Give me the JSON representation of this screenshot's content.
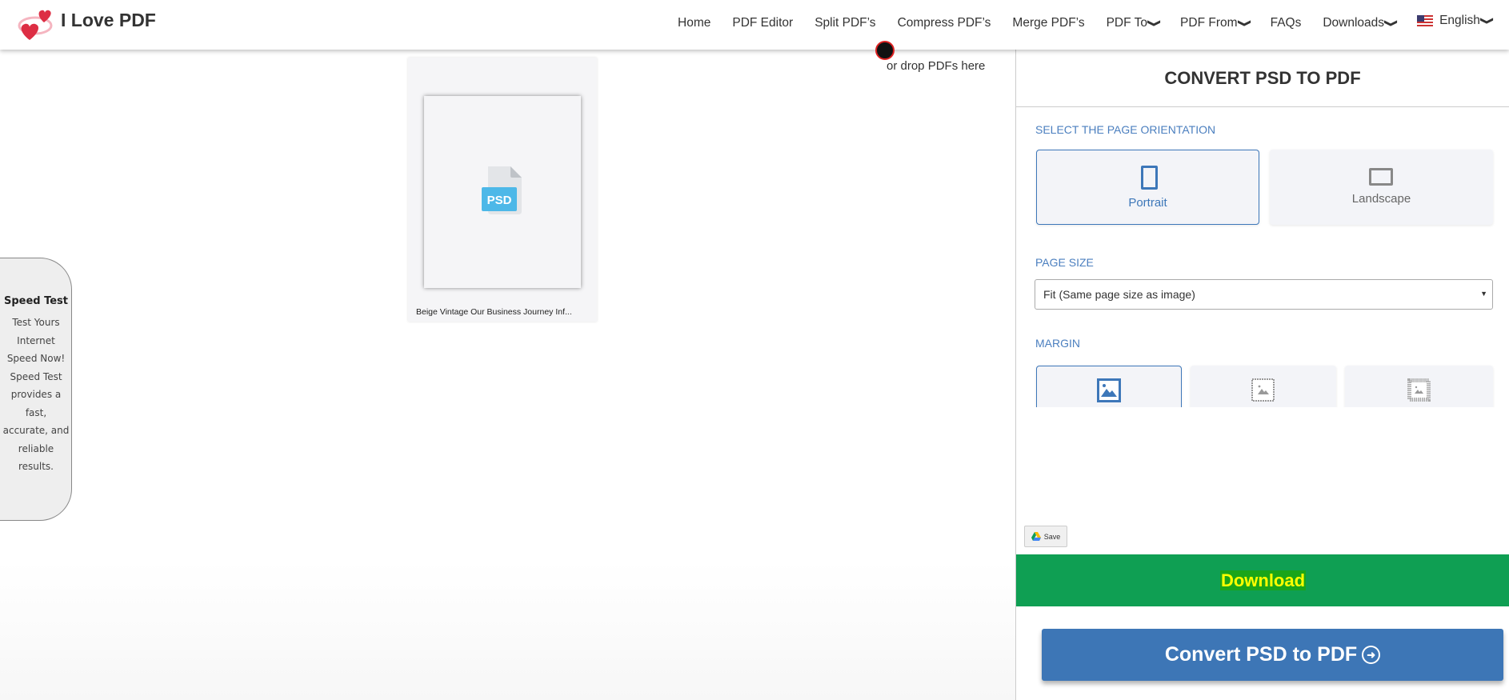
{
  "header": {
    "logo_text": "I Love PDF",
    "nav": [
      {
        "label": "Home",
        "dropdown": false
      },
      {
        "label": "PDF Editor",
        "dropdown": false
      },
      {
        "label": "Split PDF’s",
        "dropdown": false
      },
      {
        "label": "Compress PDF’s",
        "dropdown": false
      },
      {
        "label": "Merge PDF’s",
        "dropdown": false
      },
      {
        "label": "PDF To",
        "dropdown": true
      },
      {
        "label": "PDF From",
        "dropdown": true
      },
      {
        "label": "FAQs",
        "dropdown": false
      },
      {
        "label": "Downloads",
        "dropdown": true
      }
    ],
    "language": "English"
  },
  "upload": {
    "drop_text": "or drop PDFs here",
    "file": {
      "name": "Beige Vintage Our Business Journey Inf...",
      "type_badge": "PSD"
    }
  },
  "speed_test": {
    "title": "Speed Test",
    "text": "Test Yours Internet Speed Now! Speed Test provides a fast, accurate, and reliable results."
  },
  "panel": {
    "title": "CONVERT PSD TO PDF",
    "orientation_label": "SELECT THE PAGE ORIENTATION",
    "orientation_options": [
      {
        "label": "Portrait",
        "selected": true
      },
      {
        "label": "Landscape",
        "selected": false
      }
    ],
    "page_size_label": "PAGE SIZE",
    "page_size_value": "Fit (Same page size as image)",
    "margin_label": "MARGIN",
    "margin_selected_index": 0,
    "save_label": "Save",
    "download_label": "Download",
    "convert_label": "Convert PSD to PDF"
  },
  "colors": {
    "accent": "#3d76b6",
    "download_bg": "#0f9f53",
    "download_text": "#ffff00",
    "label": "#4b7fbf"
  }
}
